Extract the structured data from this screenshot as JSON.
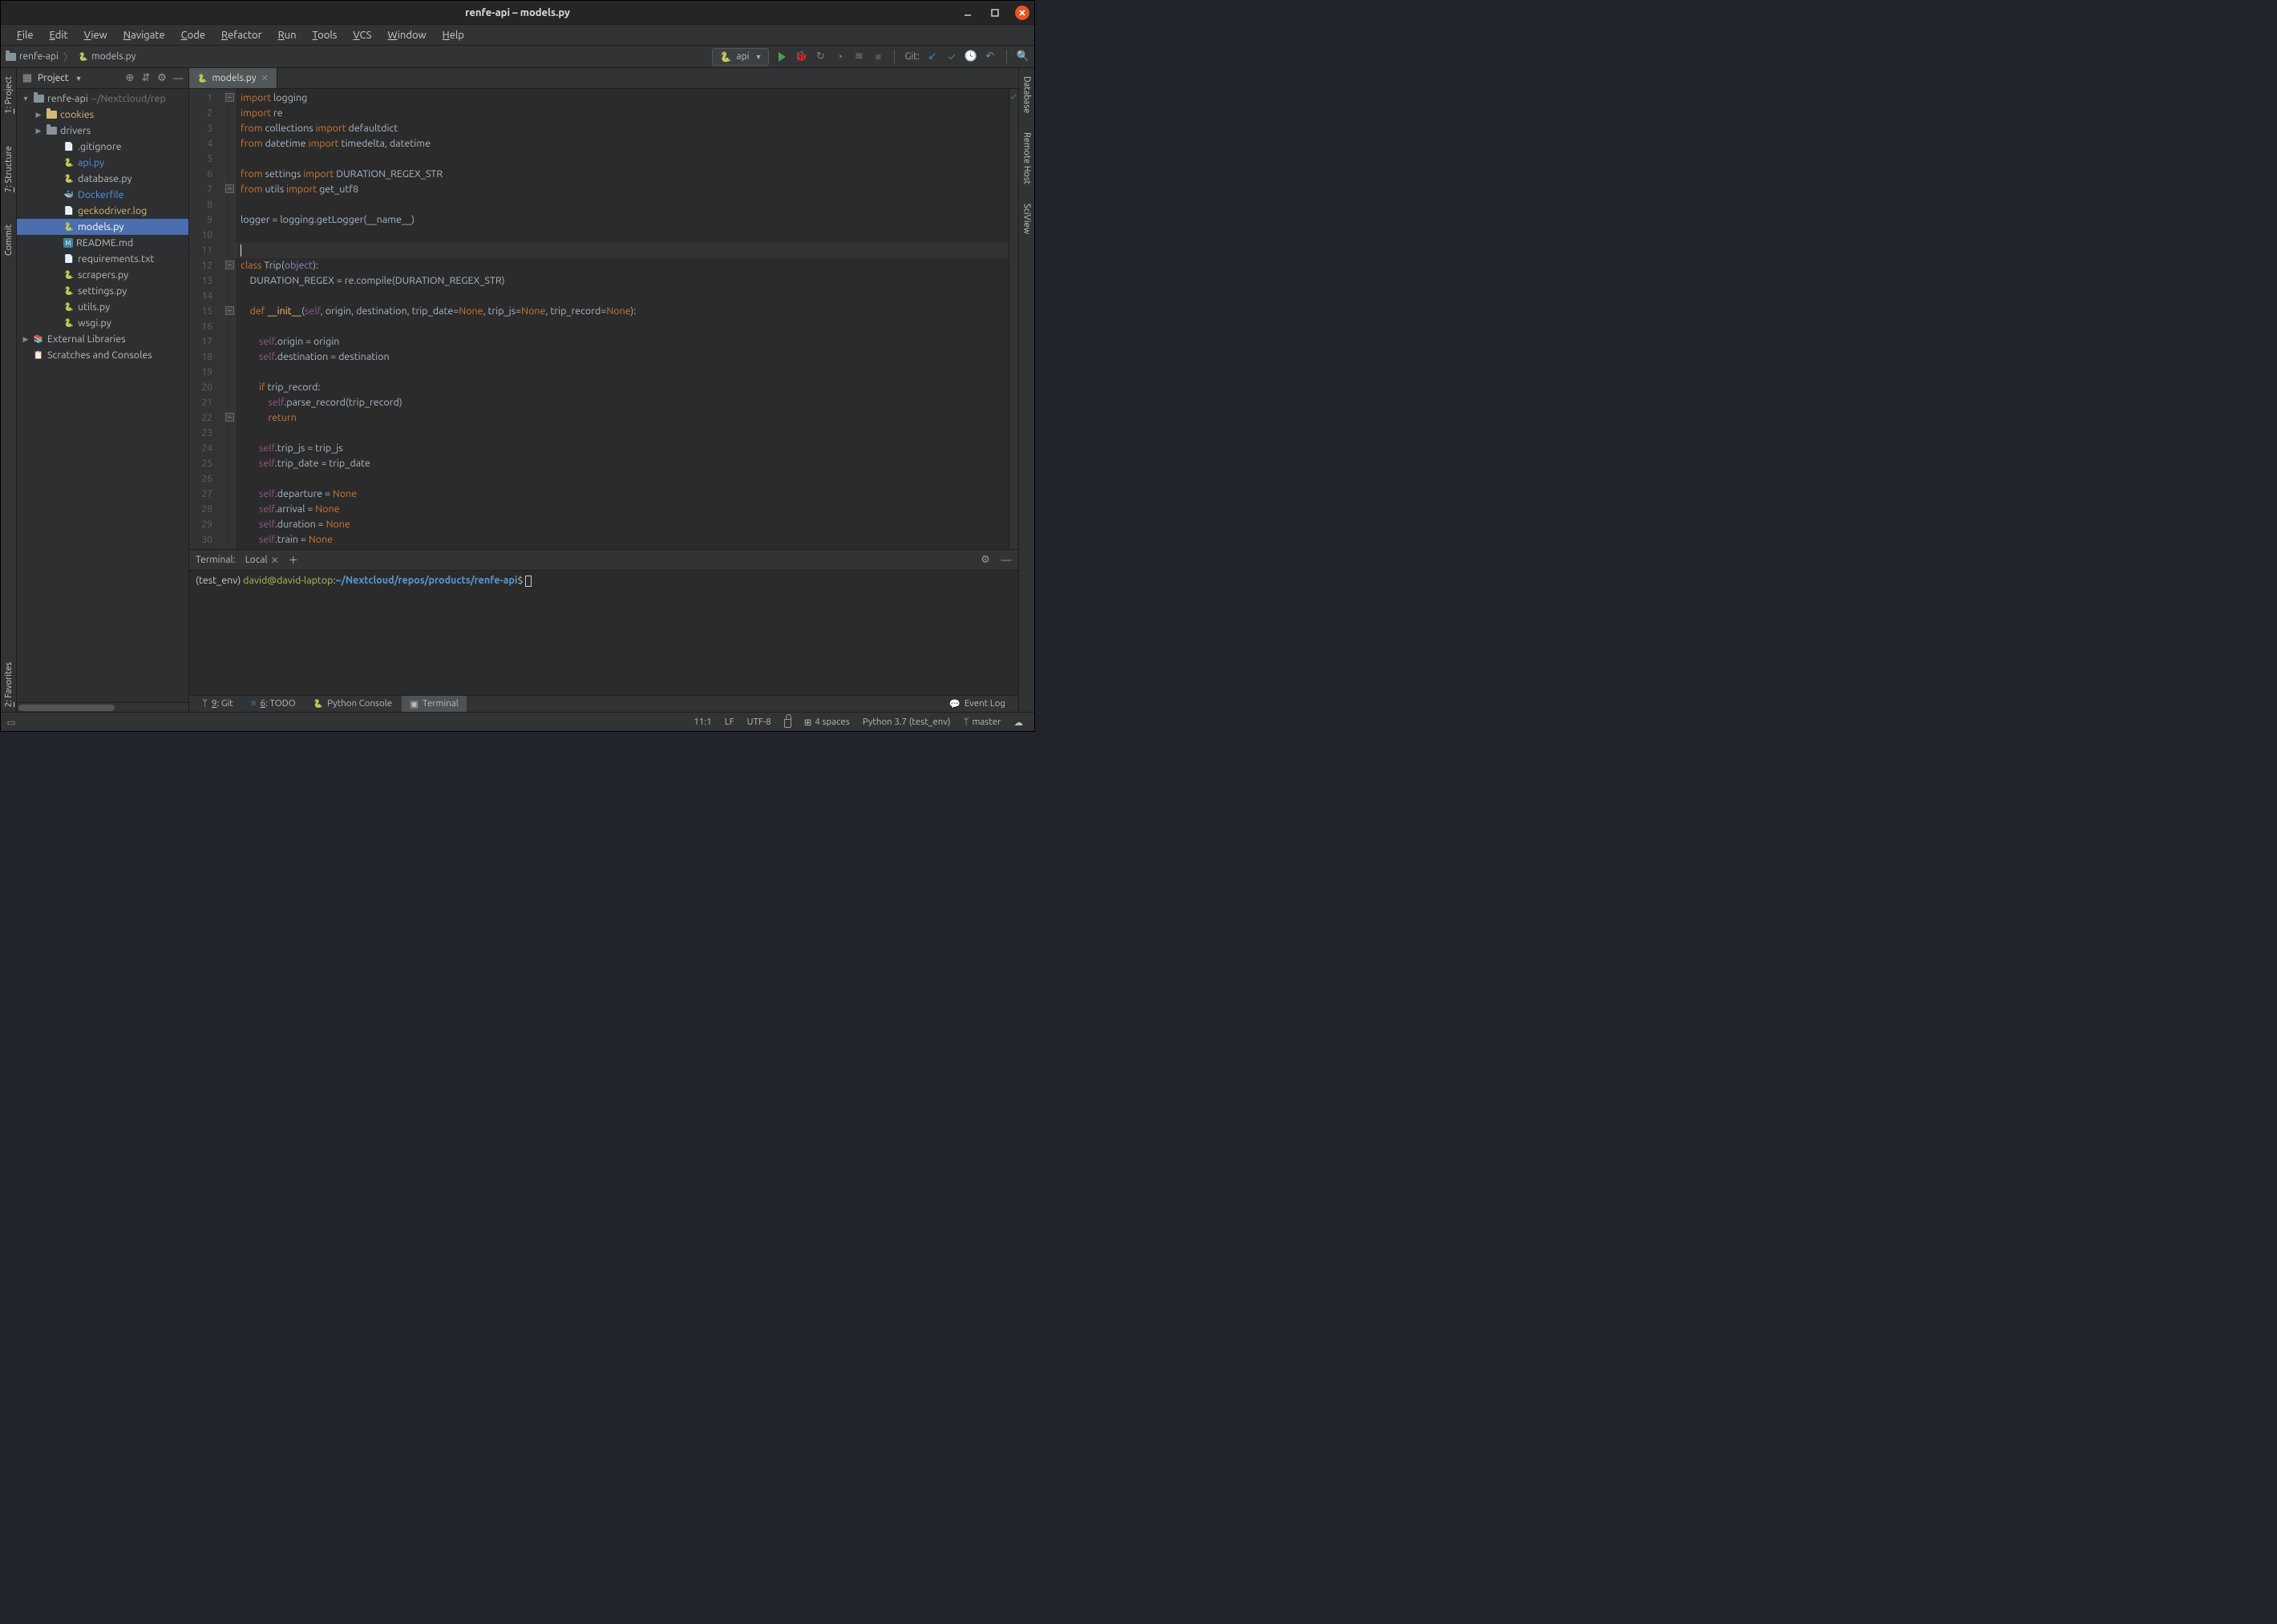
{
  "window": {
    "title": "renfe-api – models.py"
  },
  "menu": [
    "File",
    "Edit",
    "View",
    "Navigate",
    "Code",
    "Refactor",
    "Run",
    "Tools",
    "VCS",
    "Window",
    "Help"
  ],
  "breadcrumbs": [
    {
      "label": "renfe-api",
      "icon": "folder"
    },
    {
      "label": "models.py",
      "icon": "python"
    }
  ],
  "run_config": {
    "label": "api"
  },
  "git_label": "Git:",
  "left_tabs": [
    {
      "label": "1: Project",
      "underline": "1"
    },
    {
      "label": "7: Structure",
      "underline": "7"
    },
    {
      "label": "Commit"
    },
    {
      "label": "2: Favorites",
      "underline": "2"
    }
  ],
  "right_tabs": [
    {
      "label": "Database"
    },
    {
      "label": "Remote Host"
    },
    {
      "label": "SciView"
    }
  ],
  "project_panel": {
    "title": "Project",
    "tree": [
      {
        "type": "folder",
        "label": "renfe-api",
        "hint": "~/Nextcloud/rep",
        "indent": 0,
        "expanded": true,
        "style": "root"
      },
      {
        "type": "folder",
        "label": "cookies",
        "indent": 1,
        "expanded": false,
        "color": "yellow",
        "textcolor": "#d5b778"
      },
      {
        "type": "folder",
        "label": "drivers",
        "indent": 1,
        "expanded": false
      },
      {
        "type": "file",
        "label": ".gitignore",
        "indent": 2,
        "icon": "text"
      },
      {
        "type": "file",
        "label": "api.py",
        "indent": 2,
        "icon": "python",
        "textcolor": "#5394ec"
      },
      {
        "type": "file",
        "label": "database.py",
        "indent": 2,
        "icon": "python"
      },
      {
        "type": "file",
        "label": "Dockerfile",
        "indent": 2,
        "icon": "docker",
        "textcolor": "#5394ec"
      },
      {
        "type": "file",
        "label": "geckodriver.log",
        "indent": 2,
        "icon": "text",
        "textcolor": "#d5b778"
      },
      {
        "type": "file",
        "label": "models.py",
        "indent": 2,
        "icon": "python",
        "selected": true
      },
      {
        "type": "file",
        "label": "README.md",
        "indent": 2,
        "icon": "md"
      },
      {
        "type": "file",
        "label": "requirements.txt",
        "indent": 2,
        "icon": "text"
      },
      {
        "type": "file",
        "label": "scrapers.py",
        "indent": 2,
        "icon": "python"
      },
      {
        "type": "file",
        "label": "settings.py",
        "indent": 2,
        "icon": "python"
      },
      {
        "type": "file",
        "label": "utils.py",
        "indent": 2,
        "icon": "python"
      },
      {
        "type": "file",
        "label": "wsgi.py",
        "indent": 2,
        "icon": "python"
      },
      {
        "type": "lib",
        "label": "External Libraries",
        "indent": 0,
        "expanded": false
      },
      {
        "type": "scratch",
        "label": "Scratches and Consoles",
        "indent": 0
      }
    ]
  },
  "editor": {
    "tab_label": "models.py",
    "lines": [
      {
        "n": 1,
        "tokens": [
          [
            "kw",
            "import"
          ],
          [
            "",
            " logging"
          ]
        ]
      },
      {
        "n": 2,
        "tokens": [
          [
            "kw",
            "import"
          ],
          [
            "",
            " re"
          ]
        ]
      },
      {
        "n": 3,
        "tokens": [
          [
            "kw",
            "from"
          ],
          [
            "",
            " collections "
          ],
          [
            "kw",
            "import"
          ],
          [
            "",
            " defaultdict"
          ]
        ]
      },
      {
        "n": 4,
        "tokens": [
          [
            "kw",
            "from"
          ],
          [
            "",
            " datetime "
          ],
          [
            "kw",
            "import"
          ],
          [
            "",
            " timedelta, datetime"
          ]
        ]
      },
      {
        "n": 5,
        "tokens": [
          [
            "",
            ""
          ]
        ]
      },
      {
        "n": 6,
        "tokens": [
          [
            "kw",
            "from"
          ],
          [
            "",
            " settings "
          ],
          [
            "kw",
            "import"
          ],
          [
            "",
            " DURATION_REGEX_STR"
          ]
        ]
      },
      {
        "n": 7,
        "tokens": [
          [
            "kw",
            "from"
          ],
          [
            "",
            " utils "
          ],
          [
            "kw",
            "import"
          ],
          [
            "",
            " get_utf8"
          ]
        ]
      },
      {
        "n": 8,
        "tokens": [
          [
            "",
            ""
          ]
        ]
      },
      {
        "n": 9,
        "tokens": [
          [
            "",
            "logger = logging.getLogger(__name__)"
          ]
        ]
      },
      {
        "n": 10,
        "tokens": [
          [
            "",
            ""
          ]
        ]
      },
      {
        "n": 11,
        "tokens": [
          [
            "caret",
            ""
          ]
        ],
        "current": true
      },
      {
        "n": 12,
        "tokens": [
          [
            "kw",
            "class"
          ],
          [
            "",
            " Trip("
          ],
          [
            "builtin",
            "object"
          ],
          [
            "",
            "):"
          ]
        ]
      },
      {
        "n": 13,
        "tokens": [
          [
            "",
            "    DURATION_REGEX = re.compile(DURATION_REGEX_STR)"
          ]
        ]
      },
      {
        "n": 14,
        "tokens": [
          [
            "",
            ""
          ]
        ]
      },
      {
        "n": 15,
        "tokens": [
          [
            "",
            "    "
          ],
          [
            "kw",
            "def"
          ],
          [
            "",
            " "
          ],
          [
            "fn",
            "__init__"
          ],
          [
            "",
            "("
          ],
          [
            "self",
            "self"
          ],
          [
            "",
            ", origin, destination, trip_date="
          ],
          [
            "none",
            "None"
          ],
          [
            "",
            ", trip_js="
          ],
          [
            "none",
            "None"
          ],
          [
            "",
            ", trip_record="
          ],
          [
            "none",
            "None"
          ],
          [
            "",
            "):"
          ]
        ]
      },
      {
        "n": 16,
        "tokens": [
          [
            "",
            ""
          ]
        ]
      },
      {
        "n": 17,
        "tokens": [
          [
            "",
            "        "
          ],
          [
            "self",
            "self"
          ],
          [
            "",
            ".origin = origin"
          ]
        ]
      },
      {
        "n": 18,
        "tokens": [
          [
            "",
            "        "
          ],
          [
            "self",
            "self"
          ],
          [
            "",
            ".destination = destination"
          ]
        ]
      },
      {
        "n": 19,
        "tokens": [
          [
            "",
            ""
          ]
        ]
      },
      {
        "n": 20,
        "tokens": [
          [
            "",
            "        "
          ],
          [
            "kw",
            "if"
          ],
          [
            "",
            " trip_record:"
          ]
        ]
      },
      {
        "n": 21,
        "tokens": [
          [
            "",
            "            "
          ],
          [
            "self",
            "self"
          ],
          [
            "",
            ".parse_record(trip_record)"
          ]
        ]
      },
      {
        "n": 22,
        "tokens": [
          [
            "",
            "            "
          ],
          [
            "kw",
            "return"
          ]
        ]
      },
      {
        "n": 23,
        "tokens": [
          [
            "",
            ""
          ]
        ]
      },
      {
        "n": 24,
        "tokens": [
          [
            "",
            "        "
          ],
          [
            "self",
            "self"
          ],
          [
            "",
            ".trip_js = trip_js"
          ]
        ]
      },
      {
        "n": 25,
        "tokens": [
          [
            "",
            "        "
          ],
          [
            "self",
            "self"
          ],
          [
            "",
            ".trip_date = trip_date"
          ]
        ]
      },
      {
        "n": 26,
        "tokens": [
          [
            "",
            ""
          ]
        ]
      },
      {
        "n": 27,
        "tokens": [
          [
            "",
            "        "
          ],
          [
            "self",
            "self"
          ],
          [
            "",
            ".departure = "
          ],
          [
            "none",
            "None"
          ]
        ]
      },
      {
        "n": 28,
        "tokens": [
          [
            "",
            "        "
          ],
          [
            "self",
            "self"
          ],
          [
            "",
            ".arrival = "
          ],
          [
            "none",
            "None"
          ]
        ]
      },
      {
        "n": 29,
        "tokens": [
          [
            "",
            "        "
          ],
          [
            "self",
            "self"
          ],
          [
            "",
            ".duration = "
          ],
          [
            "none",
            "None"
          ]
        ]
      },
      {
        "n": 30,
        "tokens": [
          [
            "",
            "        "
          ],
          [
            "self",
            "self"
          ],
          [
            "",
            ".train = "
          ],
          [
            "none",
            "None"
          ]
        ]
      }
    ]
  },
  "terminal": {
    "title": "Terminal:",
    "tab": "Local",
    "prompt_env": "(test_env) ",
    "prompt_user": "david@david-laptop",
    "prompt_sep": ":",
    "prompt_path": "~/Nextcloud/repos/products/renfe-api",
    "prompt_end": "$ "
  },
  "bottom_tabs": [
    {
      "icon": "git",
      "label": "9: Git",
      "underline": "9"
    },
    {
      "icon": "todo",
      "label": "6: TODO",
      "underline": "6"
    },
    {
      "icon": "pyconsole",
      "label": "Python Console"
    },
    {
      "icon": "terminal",
      "label": "Terminal",
      "active": true
    }
  ],
  "event_log_label": "Event Log",
  "status": {
    "cursor": "11:1",
    "line_sep": "LF",
    "encoding": "UTF-8",
    "indent": "4 spaces",
    "interpreter": "Python 3.7 (test_env)",
    "branch": "master"
  }
}
